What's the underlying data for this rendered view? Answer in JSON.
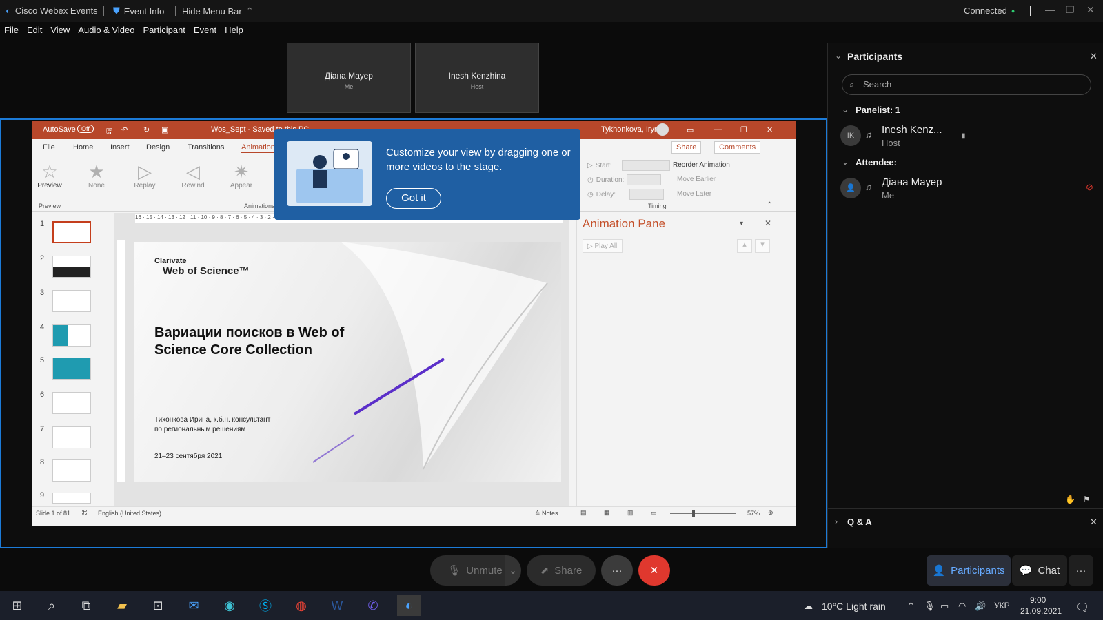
{
  "app": {
    "title": "Cisco Webex Events",
    "event_info": "Event Info",
    "hide_menu": "Hide Menu Bar",
    "status": "Connected"
  },
  "menu": [
    "File",
    "Edit",
    "View",
    "Audio & Video",
    "Participant",
    "Event",
    "Help"
  ],
  "tiles": [
    {
      "name": "Діана Мауер",
      "role": "Me"
    },
    {
      "name": "Inesh Kenzhina",
      "role": "Host"
    }
  ],
  "ppt": {
    "autosave": "AutoSave",
    "autosave_state": "Off",
    "filename": "Wos_Sept - Saved to this PC",
    "user": "Tykhonkova, Iryna",
    "tabs": [
      "File",
      "Home",
      "Insert",
      "Design",
      "Transitions",
      "Animations"
    ],
    "share": "Share",
    "comments": "Comments",
    "ribbon": {
      "preview": "Preview",
      "preview_group": "Preview",
      "animations_group": "Animations",
      "timing_group": "Timing",
      "buttons": [
        "None",
        "Replay",
        "Rewind",
        "Appear"
      ],
      "start": "Start:",
      "duration": "Duration:",
      "delay": "Delay:",
      "reorder": "Reorder Animation",
      "move_earlier": "Move Earlier",
      "move_later": "Move Later"
    },
    "ruler_h": "16 · 15 · 14 · 13 · 12 · 11 · 10 · 9 · 8 · 7 · 6 · 5 · 4 · 3 · 2 · 1 · 0 · 1 · 2 · 3 · 4 · 5 · 6 · 7 · 8 · 9 · 10 · 11 · 12 · 13 · 14 · 15 · 16",
    "slide_numbers": [
      "1",
      "2",
      "3",
      "4",
      "5",
      "6",
      "7",
      "8",
      "9"
    ],
    "slide": {
      "logo_top": "Clarivate",
      "logo_main": "Web of Science™",
      "headline": "Вариации поисков в Web of Science Core Collection",
      "author": "Тихонкова Ирина, к.б.н. консультант по региональным решениям",
      "date": "21–23 сентября 2021"
    },
    "anim_pane": {
      "title": "Animation Pane",
      "play_all": "Play All"
    },
    "status": {
      "slide_of": "Slide 1 of 81",
      "language": "English (United States)",
      "notes": "Notes",
      "zoom": "57%"
    }
  },
  "tooltip": {
    "message": "Customize your view by dragging one or more videos to the stage.",
    "button": "Got it"
  },
  "participants": {
    "title": "Participants",
    "search_placeholder": "Search",
    "panelist_header": "Panelist: 1",
    "attendee_header": "Attendee:",
    "panelist": {
      "initials": "IK",
      "name": "Inesh Kenz...",
      "role": "Host"
    },
    "attendee": {
      "name": "Діана Мауер",
      "role": "Me"
    },
    "qa": "Q & A"
  },
  "controls": {
    "unmute": "Unmute",
    "share": "Share",
    "participants": "Participants",
    "chat": "Chat"
  },
  "taskbar": {
    "weather": "10°C  Light rain",
    "lang": "УКР",
    "time": "9:00",
    "date": "21.09.2021"
  },
  "colors": {
    "accent": "#1c7bd8",
    "ppt_title": "#b7472a",
    "end_call": "#e0382e",
    "tooltip": "#1f5fa3",
    "connected": "#2ecc71"
  }
}
